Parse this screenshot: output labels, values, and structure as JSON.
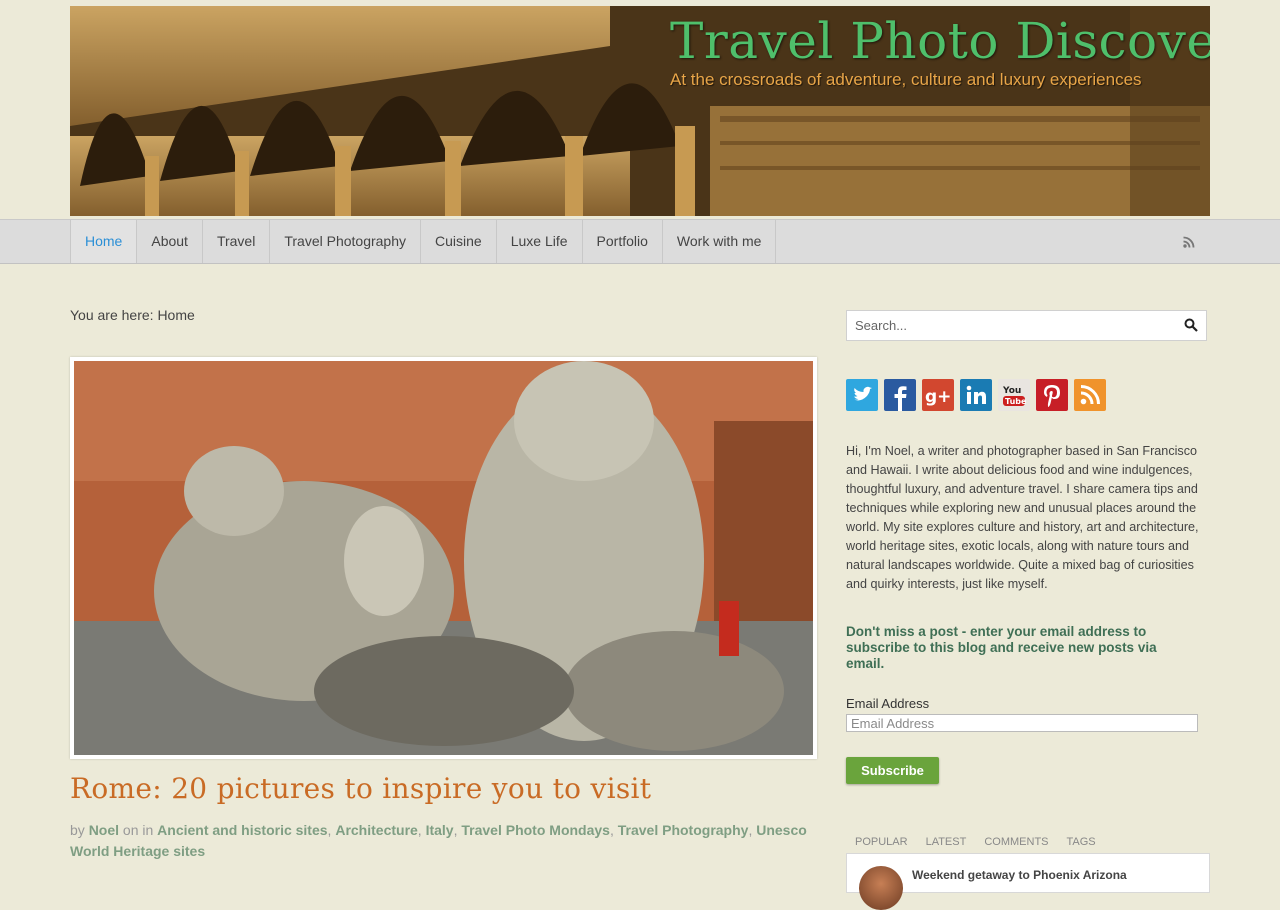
{
  "header": {
    "title": "Travel Photo Discovery",
    "tagline": "At the crossroads of adventure, culture and luxury experiences"
  },
  "nav": {
    "items": [
      {
        "label": "Home",
        "active": true
      },
      {
        "label": "About"
      },
      {
        "label": "Travel"
      },
      {
        "label": "Travel Photography"
      },
      {
        "label": "Cuisine"
      },
      {
        "label": "Luxe Life"
      },
      {
        "label": "Portfolio"
      },
      {
        "label": "Work with me"
      }
    ],
    "rss_icon": "rss-icon"
  },
  "breadcrumb": "You are here: Home",
  "post": {
    "title": "Rome: 20 pictures to inspire you to visit",
    "by": "by",
    "author": "Noel",
    "on_in": "on in",
    "categories": [
      "Ancient and historic sites",
      "Architecture",
      "Italy",
      "Travel Photo Mondays",
      "Travel Photography",
      "Unesco World Heritage sites"
    ]
  },
  "sidebar": {
    "search_placeholder": "Search...",
    "socials": [
      {
        "name": "twitter-icon",
        "color": "#2fa7df"
      },
      {
        "name": "facebook-icon",
        "color": "#2a5aa0"
      },
      {
        "name": "google-plus-icon",
        "color": "#d2472f"
      },
      {
        "name": "linkedin-icon",
        "color": "#1a7bb3"
      },
      {
        "name": "youtube-icon",
        "color": "#e9e5e0"
      },
      {
        "name": "pinterest-icon",
        "color": "#c71f27"
      },
      {
        "name": "rss-icon",
        "color": "#f0932b"
      }
    ],
    "bio": "Hi, I'm Noel, a writer and photographer based in San Francisco and Hawaii. I write about delicious food and wine indulgences, thoughtful luxury, and adventure travel. I share camera tips and techniques while exploring new and unusual places around the world. My site explores culture and history, art and architecture, world heritage sites, exotic locals, along with nature tours and natural landscapes worldwide. Quite a mixed bag of curiosities and quirky interests, just like myself.",
    "subscribe_heading": "Don't miss a post - enter your email address to subscribe to this blog and receive new posts via email.",
    "email_label": "Email Address",
    "email_placeholder": "Email Address",
    "subscribe_button": "Subscribe",
    "tabs": [
      "POPULAR",
      "LATEST",
      "COMMENTS",
      "TAGS"
    ],
    "popular_first": "Weekend getaway to Phoenix Arizona"
  },
  "colors": {
    "accent": "#2b8fd6",
    "title_orange": "#c96b25",
    "link_green": "#7f9e83",
    "subscribe_green": "#6aa43c",
    "background": "#ecead8"
  }
}
